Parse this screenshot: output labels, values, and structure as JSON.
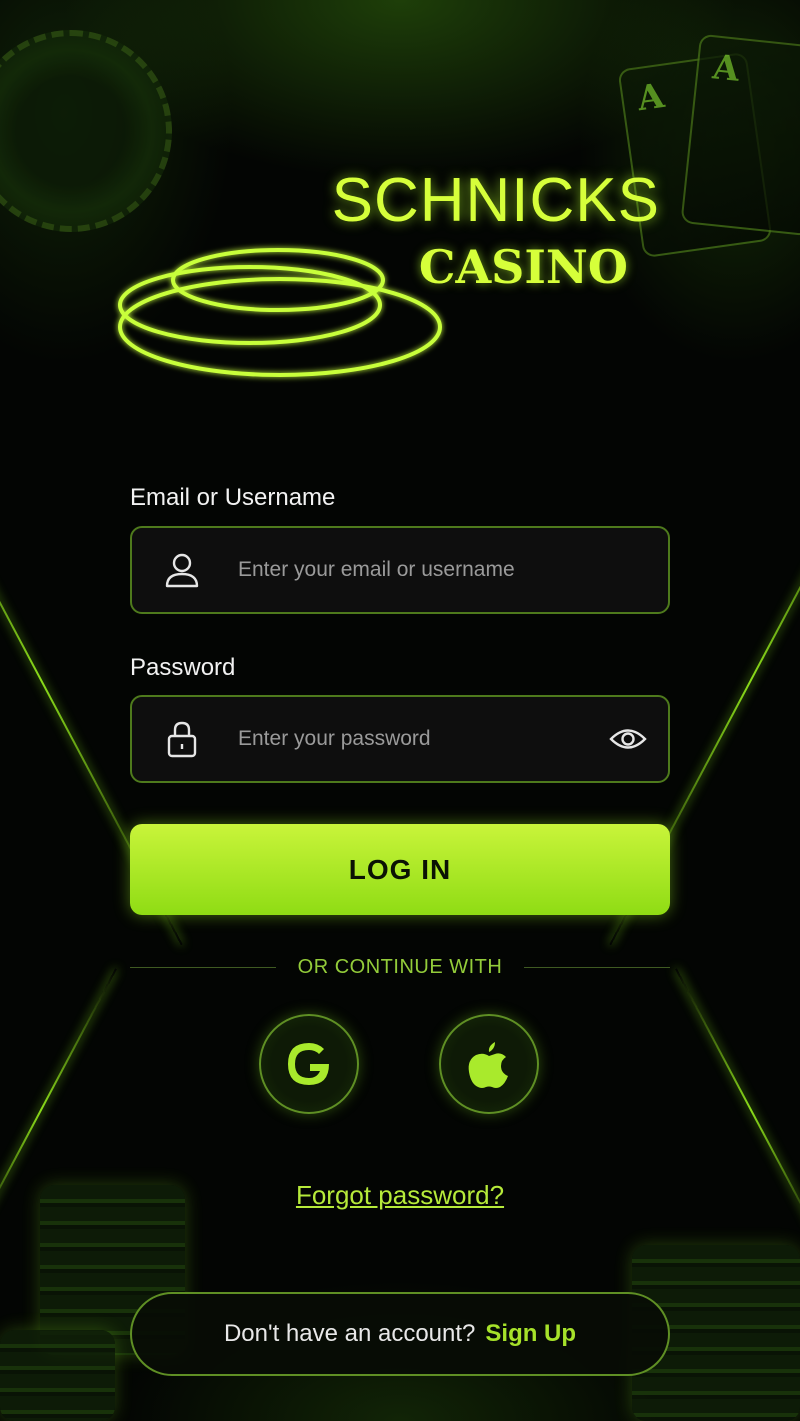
{
  "brand": {
    "name_top": "SCHNICKS",
    "name_bottom": "CASINO",
    "accent_color": "#a6e22a"
  },
  "login_form": {
    "email_label": "Email or Username",
    "email_placeholder": "Enter your email or username",
    "email_icon": "user-icon",
    "password_label": "Password",
    "password_placeholder": "Enter your password",
    "password_icon": "lock-icon",
    "toggle_visibility_icon": "eye-icon",
    "submit_label": "LOG IN"
  },
  "social_login": {
    "divider_text": "OR CONTINUE WITH",
    "providers": [
      {
        "name": "Google",
        "icon": "google-icon"
      },
      {
        "name": "Apple",
        "icon": "apple-icon"
      }
    ]
  },
  "forgot_password": "Forgot password?",
  "signup": {
    "prompt": "Don't have an account?",
    "link_label": "Sign Up"
  }
}
